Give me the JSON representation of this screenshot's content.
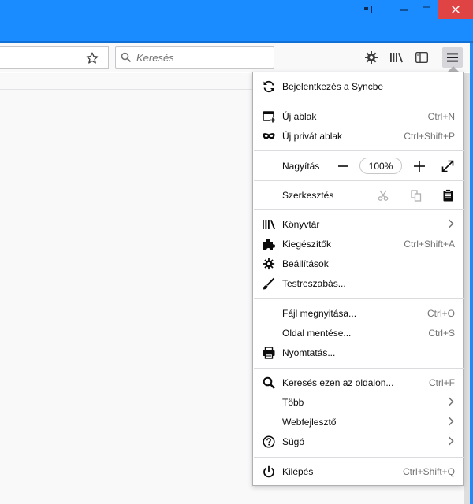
{
  "toolbar": {
    "search_placeholder": "Keresés"
  },
  "menu": {
    "sync": "Bejelentkezés a Syncbe",
    "new_window": {
      "label": "Új ablak",
      "shortcut": "Ctrl+N"
    },
    "new_private": {
      "label": "Új privát ablak",
      "shortcut": "Ctrl+Shift+P"
    },
    "zoom": {
      "label": "Nagyítás",
      "value": "100%"
    },
    "edit": {
      "label": "Szerkesztés"
    },
    "library": "Könyvtár",
    "addons": {
      "label": "Kiegészítők",
      "shortcut": "Ctrl+Shift+A"
    },
    "options": "Beállítások",
    "customize": "Testreszabás...",
    "open_file": {
      "label": "Fájl megnyitása...",
      "shortcut": "Ctrl+O"
    },
    "save_page": {
      "label": "Oldal mentése...",
      "shortcut": "Ctrl+S"
    },
    "print": "Nyomtatás...",
    "find": {
      "label": "Keresés ezen az oldalon...",
      "shortcut": "Ctrl+F"
    },
    "more": "Több",
    "web_dev": "Webfejlesztő",
    "help": "Súgó",
    "quit": {
      "label": "Kilépés",
      "shortcut": "Ctrl+Shift+Q"
    }
  },
  "colors": {
    "titlebar": "#1a8cff",
    "close_button": "#e04343"
  }
}
